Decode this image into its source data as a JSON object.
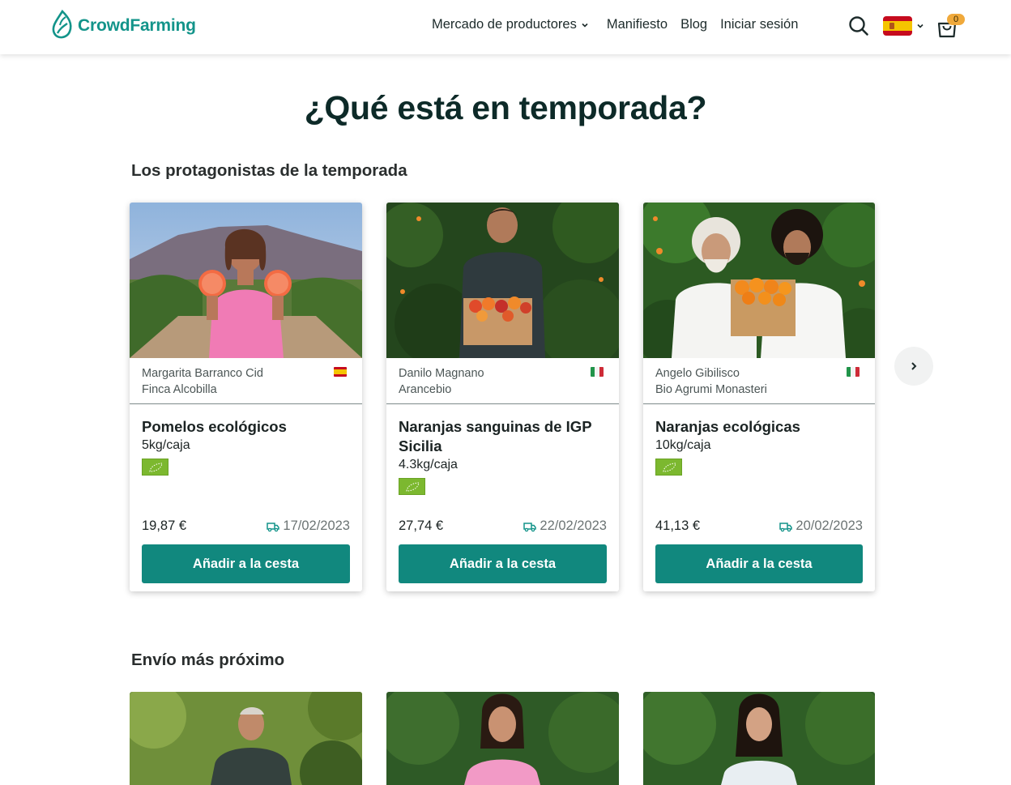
{
  "header": {
    "logo_text": "CrowdFarming",
    "nav": [
      {
        "label": "Mercado de productores",
        "has_dropdown": true
      },
      {
        "label": "Manifiesto"
      },
      {
        "label": "Blog"
      },
      {
        "label": "Iniciar sesión"
      }
    ],
    "language_flag": "es",
    "cart_count": "0"
  },
  "page_title": "¿Qué está en temporada?",
  "sections": [
    {
      "title": "Los protagonistas de la temporada",
      "cards": [
        {
          "farmer": "Margarita Barranco Cid",
          "farm": "Finca Alcobilla",
          "country_flag": "es",
          "product": "Pomelos ecológicos",
          "size": "5kg/caja",
          "organic": true,
          "price": "19,87 €",
          "ship_date": "17/02/2023",
          "button": "Añadir a la cesta"
        },
        {
          "farmer": "Danilo Magnano",
          "farm": "Arancebio",
          "country_flag": "it",
          "product": "Naranjas sanguinas de IGP Sicilia",
          "size": "4.3kg/caja",
          "organic": true,
          "price": "27,74 €",
          "ship_date": "22/02/2023",
          "button": "Añadir a la cesta"
        },
        {
          "farmer": "Angelo Gibilisco",
          "farm": "Bio Agrumi Monasteri",
          "country_flag": "it",
          "product": "Naranjas ecológicas",
          "size": "10kg/caja",
          "organic": true,
          "price": "41,13 €",
          "ship_date": "20/02/2023",
          "button": "Añadir a la cesta"
        }
      ]
    },
    {
      "title": "Envío más próximo"
    }
  ],
  "colors": {
    "brand": "#13948a",
    "button": "#11887e",
    "cart_badge": "#f0a93b",
    "organic_badge": "#7cb82f"
  }
}
